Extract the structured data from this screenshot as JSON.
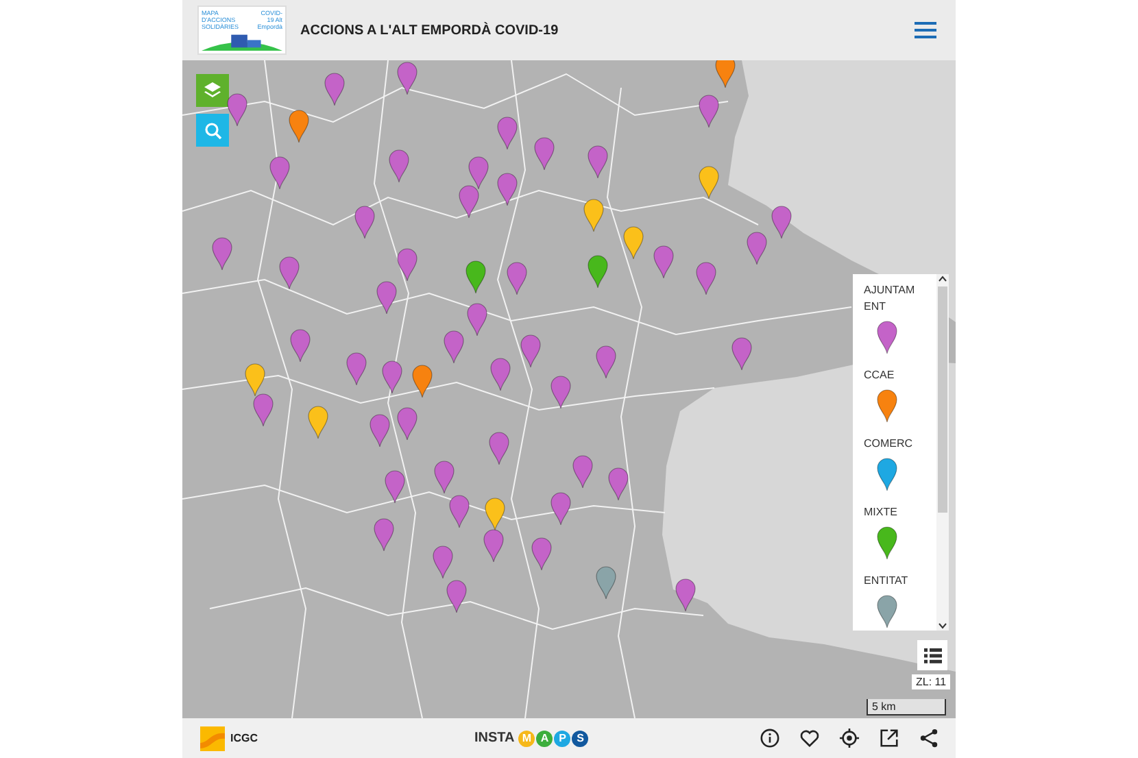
{
  "header": {
    "logo_title": "MAPA D'ACCIONS SOLIDÀRIES",
    "logo_subtitle": "COVID-19 Alt Empordà",
    "title": "ACCIONS A L'ALT EMPORDÀ COVID-19"
  },
  "markers": [
    {
      "color": "#c463c8"
    },
    {
      "color": "#c463c8"
    },
    {
      "color": "#c463c8"
    },
    {
      "color": "#f7820f"
    },
    {
      "color": "#f7820f"
    },
    {
      "color": "#c463c8"
    },
    {
      "color": "#c463c8"
    },
    {
      "color": "#c463c8"
    },
    {
      "color": "#c463c8"
    },
    {
      "color": "#c463c8"
    },
    {
      "color": "#c463c8"
    },
    {
      "color": "#c463c8"
    },
    {
      "color": "#c463c8"
    },
    {
      "color": "#c463c8"
    },
    {
      "color": "#fbc01a"
    },
    {
      "color": "#fbc01a"
    },
    {
      "color": "#c463c8"
    },
    {
      "color": "#c463c8"
    },
    {
      "color": "#fbc01a"
    },
    {
      "color": "#c463c8"
    },
    {
      "color": "#c463c8"
    },
    {
      "color": "#c463c8"
    },
    {
      "color": "#c463c8"
    },
    {
      "color": "#c463c8"
    },
    {
      "color": "#48b81c"
    },
    {
      "color": "#c463c8"
    },
    {
      "color": "#48b81c"
    },
    {
      "color": "#c463c8"
    },
    {
      "color": "#c463c8"
    },
    {
      "color": "#c463c8"
    },
    {
      "color": "#c463c8"
    },
    {
      "color": "#c463c8"
    },
    {
      "color": "#c463c8"
    },
    {
      "color": "#c463c8"
    },
    {
      "color": "#c463c8"
    },
    {
      "color": "#c463c8"
    },
    {
      "color": "#f7820f"
    },
    {
      "color": "#c463c8"
    },
    {
      "color": "#c463c8"
    },
    {
      "color": "#c463c8"
    },
    {
      "color": "#fbc01a"
    },
    {
      "color": "#c463c8"
    },
    {
      "color": "#fbc01a"
    },
    {
      "color": "#c463c8"
    },
    {
      "color": "#c463c8"
    },
    {
      "color": "#c463c8"
    },
    {
      "color": "#c463c8"
    },
    {
      "color": "#c463c8"
    },
    {
      "color": "#c463c8"
    },
    {
      "color": "#c463c8"
    },
    {
      "color": "#c463c8"
    },
    {
      "color": "#fbc01a"
    },
    {
      "color": "#c463c8"
    },
    {
      "color": "#c463c8"
    },
    {
      "color": "#c463c8"
    },
    {
      "color": "#c463c8"
    },
    {
      "color": "#c463c8"
    },
    {
      "color": "#c463c8"
    },
    {
      "color": "#8aa4a8"
    },
    {
      "color": "#c463c8"
    }
  ],
  "legend": [
    {
      "label": "AJUNTAMENT",
      "color": "#c463c8"
    },
    {
      "label": "CCAE",
      "color": "#f7820f"
    },
    {
      "label": "COMERC",
      "color": "#1ea8e2"
    },
    {
      "label": "MIXTE",
      "color": "#48b81c"
    },
    {
      "label": "ENTITAT",
      "color": "#8aa4a8"
    }
  ],
  "zoom_level": "ZL: 11",
  "scale": "5 km",
  "footer": {
    "provider": "ICGC",
    "brand": "INSTA",
    "brand_letters": [
      {
        "letter": "M",
        "color": "#f6b81a"
      },
      {
        "letter": "A",
        "color": "#3cae3c"
      },
      {
        "letter": "P",
        "color": "#1ea8e2"
      },
      {
        "letter": "S",
        "color": "#11589e"
      }
    ]
  }
}
